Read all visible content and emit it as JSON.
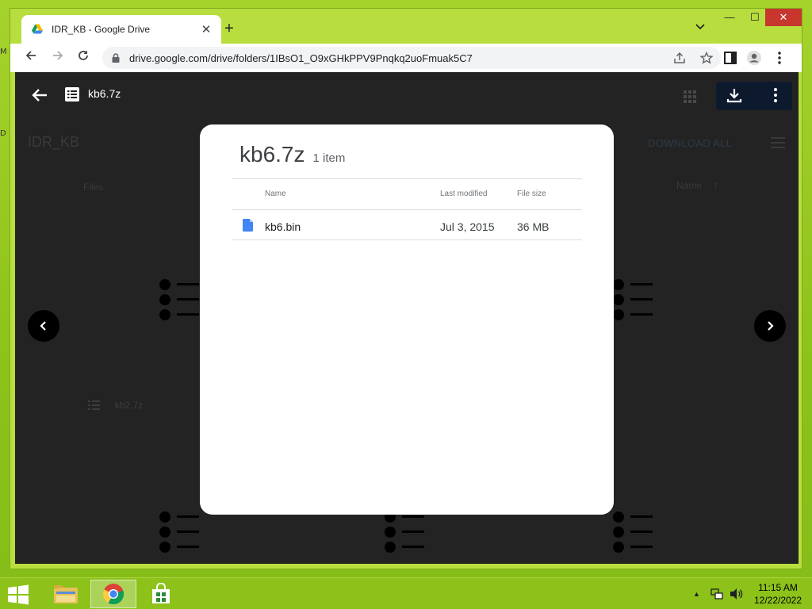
{
  "browser": {
    "tab_title": "IDR_KB - Google Drive",
    "url": "drive.google.com/drive/folders/1IBsO1_O9xGHkPPV9Pnqkq2uoFmuak5C7"
  },
  "viewer": {
    "file_title": "kb6.7z"
  },
  "background": {
    "folder_title": "IDR_KB",
    "download_all": "DOWNLOAD ALL",
    "files_label": "Files",
    "name_sort_label": "Name",
    "sort_arrow": "↑",
    "other_file": "kb2.7z"
  },
  "archive": {
    "title": "kb6.7z",
    "count": "1 item",
    "columns": {
      "name": "Name",
      "last_modified": "Last modified",
      "file_size": "File size"
    },
    "rows": [
      {
        "name": "kb6.bin",
        "modified": "Jul 3, 2015",
        "size": "36 MB"
      }
    ]
  },
  "taskbar": {
    "time": "11:15 AM",
    "date": "12/22/2022"
  },
  "desktop": {
    "edge_label_1": "M",
    "edge_label_2": "D"
  },
  "colors": {
    "desktop_green": "#8cc21a",
    "window_frame": "#b8dd3e",
    "close_red": "#c7372e",
    "overlay": "#232323",
    "file_blue": "#4285f4"
  },
  "icons": {
    "tab_favicon": "google-drive-icon",
    "row_file": "document-icon",
    "viewer_file": "archive-list-icon"
  }
}
